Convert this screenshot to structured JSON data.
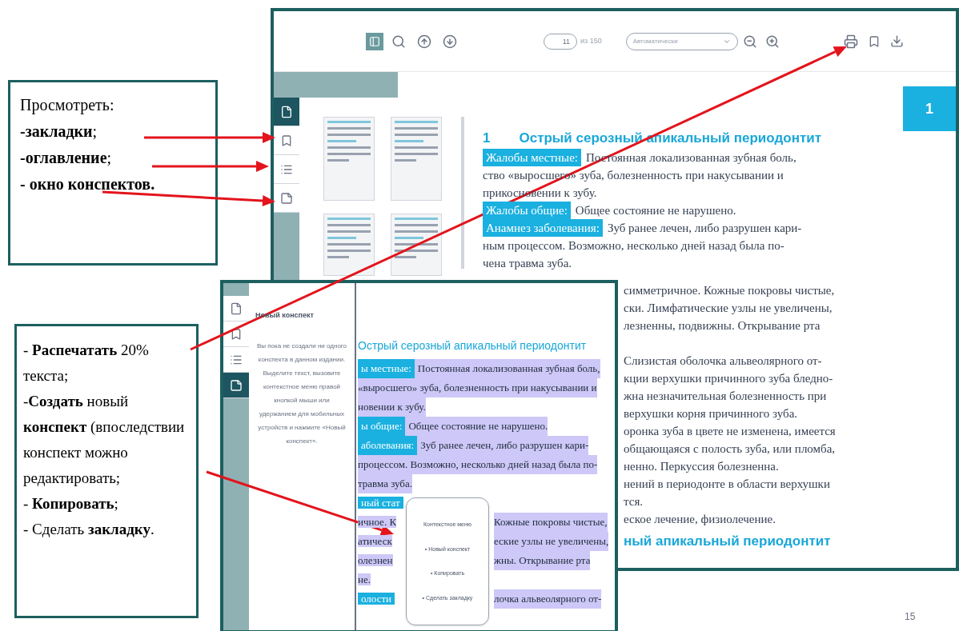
{
  "view_note": {
    "lines": [
      "Просмотреть:",
      "**-закладки**;",
      "**-оглавление**;",
      "**- окно конспектов.**"
    ]
  },
  "actions_note": {
    "items": [
      "- **Распечатать** 20% текста;",
      "-**Создать** новый **конспект** (впоследствии конспект можно редактировать;",
      "- **Копировать**;",
      "- Сделать **закладку**."
    ]
  },
  "main_window": {
    "toolbar": {
      "sidebar_toggle_selected": true,
      "page_input": "11",
      "page_total": "из 150",
      "zoom_select": "Автоматически"
    },
    "sidebar_tabs": [
      {
        "kind": "pages",
        "selected": true
      },
      {
        "kind": "bookmarks",
        "selected": false
      },
      {
        "kind": "contents",
        "selected": false
      },
      {
        "kind": "notes",
        "selected": false
      }
    ],
    "page_badge": "1",
    "heading_number": "1",
    "heading": "Острый серозный апикальный периодонтит",
    "lines": [
      {
        "label": "Жалобы местные:",
        "text": "Постоянная локализованная зубная боль,"
      },
      {
        "text": "ство «выросшего» зуба, болезненность при накусывании и"
      },
      {
        "text": "прикосновении к зубу."
      },
      {
        "label": "Жалобы общие:",
        "text": "Общее состояние не нарушено."
      },
      {
        "label": "Анамнез заболевания:",
        "text": "Зуб ранее лечен, либо разрушен кари-"
      },
      {
        "text": "ным процессом. Возможно, несколько дней назад была по-"
      },
      {
        "text": "чена травма зуба."
      }
    ],
    "lines_right": [
      {
        "text": "симметричное. Кожные покровы чистые,",
        "gap_before": false
      },
      {
        "text": "ски. Лимфатические узлы не увеличены,",
        "gap_before": false
      },
      {
        "text": "лезненны, подвижны. Открывание рта",
        "gap_before": false
      },
      {
        "text": "Слизистая оболочка альвеолярного от-",
        "gap_before": true
      },
      {
        "text": "кции верхушки причинного зуба бледно-",
        "gap_before": false
      },
      {
        "text": "жна незначительная болезненность при",
        "gap_before": false
      },
      {
        "text": "верхушки корня причинного зуба.",
        "gap_before": false
      },
      {
        "text": "оронка зуба в цвете не изменена, имеется",
        "gap_before": false
      },
      {
        "text": "общающаяся с полость зуба, или пломба,",
        "gap_before": false
      },
      {
        "text": "ненно. Перкуссия болезненна.",
        "gap_before": false
      },
      {
        "text": "нений в периодонте в области верхушки",
        "gap_before": false
      },
      {
        "text": "тся.",
        "gap_before": false
      },
      {
        "text": "еское лечение, физиолечение.",
        "gap_before": false
      }
    ],
    "next_heading": "ный апикальный периодонтит"
  },
  "notes_window": {
    "tabs": [
      {
        "kind": "pages",
        "selected": false
      },
      {
        "kind": "bookmarks",
        "selected": false
      },
      {
        "kind": "contents",
        "selected": false
      },
      {
        "kind": "notes",
        "selected": true
      }
    ],
    "notes_title": "Новый конспект",
    "notes_text": "Вы пока не создали ни одного конспекта в данном издании. Выделите текст, вызовите контекстное меню правой кнопкой мыши или удержанием для мобильных устройств и нажмите «Новый конспект».",
    "heading": "Острый серозный апикальный периодонтит",
    "lines": [
      {
        "label": "ы местные:",
        "text": "Постоянная локализованная зубная боль,"
      },
      {
        "text": "«выросшего» зуба, болезненность при накусывании и"
      },
      {
        "text": "новении к зубу."
      },
      {
        "label": "ы общие:",
        "text": "Общее состояние не нарушено."
      },
      {
        "label": "аболевания:",
        "text": "Зуб ранее лечен, либо разрушен кари-"
      },
      {
        "text": "процессом. Возможно, несколько дней назад была по-"
      },
      {
        "text": "травма зуба."
      }
    ],
    "partial_lines": [
      {
        "left": "ный стат",
        "left_label": true
      },
      {
        "left": "ичное. К",
        "left_label": false,
        "right": "Кожные покровы чистые,"
      },
      {
        "left": "атическ",
        "left_label": false,
        "right": "еские узлы не увеличены,"
      },
      {
        "left": "олезнен",
        "left_label": false,
        "right": "жны. Открывание рта"
      },
      {
        "left": "не.",
        "left_label": false
      },
      {
        "left": "олости",
        "left_label": true,
        "right": "лочка альвеолярного от-"
      }
    ],
    "context_menu": {
      "title": "Контекстное меню",
      "items": [
        "• Новый конспект",
        "• Копировать",
        "• Сделать закладку"
      ]
    }
  },
  "slide_number": "15"
}
